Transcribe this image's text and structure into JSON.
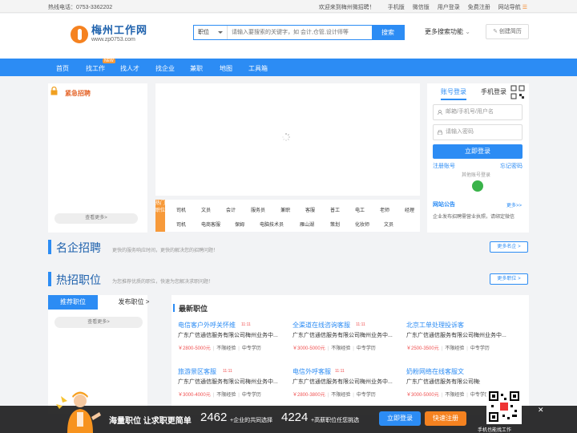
{
  "topbar": {
    "phone": "热线电话：0753-3362202",
    "welcome": "欢迎来到梅州微招聘！",
    "links": [
      "手机版",
      "微信版",
      "用户登录",
      "免费注册",
      "网站导航"
    ]
  },
  "header": {
    "logo_cn": "梅州工作网",
    "logo_en": "www.zp0753.com",
    "search_type": "职位",
    "search_placeholder": "请输入要搜索的关键字，如 会计,仓管,设计师等",
    "search_button": "搜索",
    "more_search": "更多搜索功能",
    "create_resume": "创建简历"
  },
  "nav": {
    "items": [
      "首页",
      "找工作",
      "找人才",
      "找企业",
      "兼职",
      "地图",
      "工具箱"
    ],
    "badge": "NEW"
  },
  "urgent": {
    "title": "紧急招聘",
    "more": "查看更多>"
  },
  "hot_categories": {
    "label": "热门职位",
    "row1": [
      "司机",
      "文员",
      "会计",
      "服务员",
      "兼职",
      "客服",
      "普工",
      "电工",
      "老师",
      "经理"
    ],
    "row2": [
      "司机",
      "电商客服",
      "保姆",
      "电脑技术员",
      "雁山湖",
      "策划",
      "化妆师",
      "文员"
    ]
  },
  "login": {
    "tab_account": "账号登录",
    "tab_mobile": "手机登录",
    "username_placeholder": "邮箱/手机号/用户名",
    "password_placeholder": "请输入密码",
    "login_button": "立即登录",
    "register": "注册账号",
    "forgot": "忘记密码",
    "other": "其他账号登录"
  },
  "notice": {
    "title": "网站公告",
    "more": "更多>>",
    "text": "企业发布招聘需营业执照，请绑定微信"
  },
  "famous": {
    "title": "名企招聘",
    "subtitle": "更快的服务响应时间，更快的解决您的招聘问题！",
    "more": "更多名企 >"
  },
  "hot_jobs": {
    "title": "热招职位",
    "subtitle": "为您推荐优质的职位，快速为您解决求职问题！",
    "more": "更多职位 >",
    "tab_recommend": "推荐职位",
    "tab_publish": "发布职位 >",
    "see_more": "查看更多>"
  },
  "latest": {
    "title": "最新职位",
    "jobs": [
      {
        "title": "电信客户外呼关怀维",
        "time": "11:11",
        "company": "广东广信通信服务有限公司梅州业务中...",
        "salary": "￥2800-5000元",
        "exp": "不限经验",
        "edu": "中专学历"
      },
      {
        "title": "全渠道在线咨询客服",
        "time": "11:11",
        "company": "广东广信通信服务有限公司梅州业务中...",
        "salary": "￥3000-5000元",
        "exp": "不限经验",
        "edu": "中专学历"
      },
      {
        "title": "北京工单处理投诉客",
        "time": "11:11",
        "company": "广东广信通信服务有限公司梅州业务中...",
        "salary": "￥2500-3500元",
        "exp": "不限经验",
        "edu": "中专学历"
      },
      {
        "title": "旅游景区客服",
        "time": "11:11",
        "company": "广东广信通信服务有限公司梅州业务中...",
        "salary": "￥3000-4000元",
        "exp": "不限经验",
        "edu": "中专学历"
      },
      {
        "title": "电信外呼客服",
        "time": "11:11",
        "company": "广东广信通信服务有限公司梅州业务中...",
        "salary": "￥2800-3800元",
        "exp": "不限经验",
        "edu": "中专学历"
      },
      {
        "title": "奶粉网络在线客服文",
        "time": "11:11",
        "company": "广东广信通信服务有限公司梅州业务中...",
        "salary": "￥3000-5000元",
        "exp": "不限经验",
        "edu": "中专学历"
      }
    ]
  },
  "bottom": {
    "slogan": "海量职位 让求职更简单",
    "companies_num": "2462",
    "companies_label": "+企业的共同选择",
    "jobs_num": "4224",
    "jobs_label": "+高薪职位任您挑选",
    "login_button": "立即登录",
    "register_button": "快速注册",
    "qr_text": "手机也能找工作"
  }
}
